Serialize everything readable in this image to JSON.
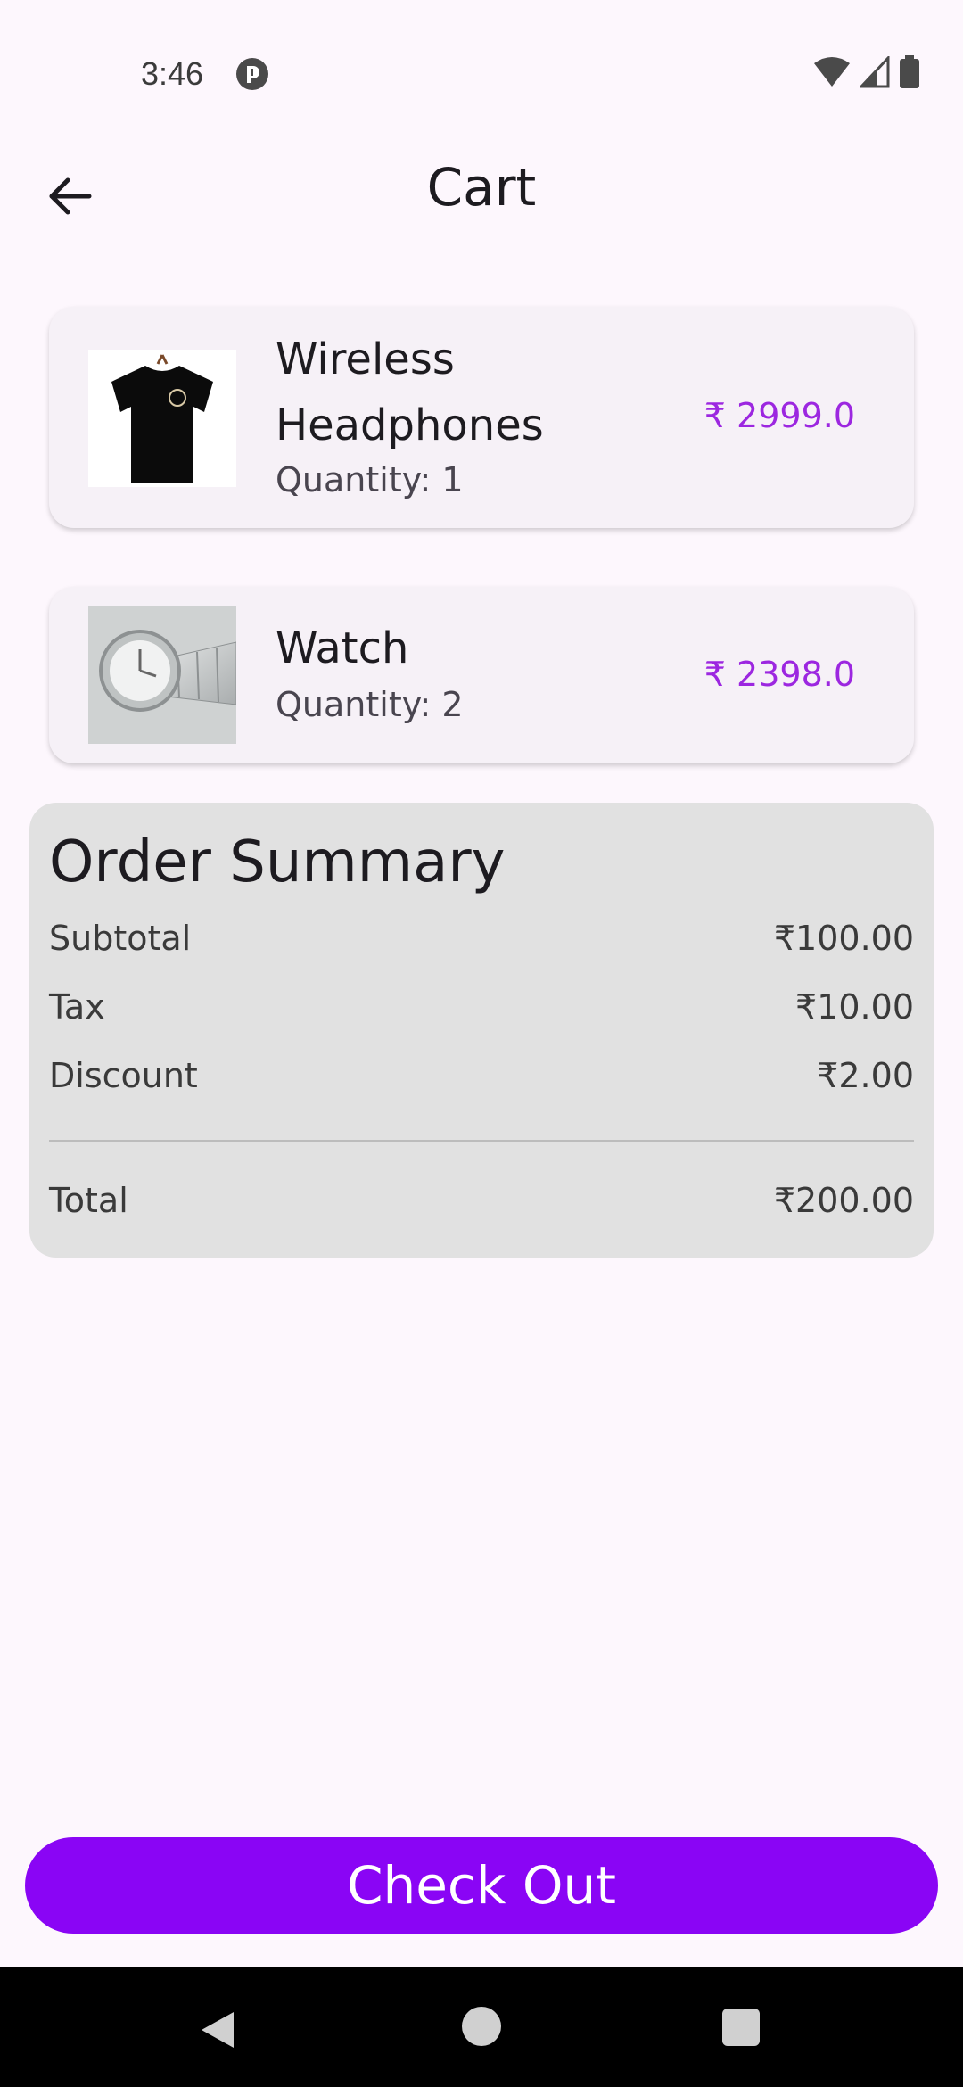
{
  "status_bar": {
    "time": "3:46"
  },
  "app_bar": {
    "title": "Cart"
  },
  "cart": {
    "items": [
      {
        "name": "Wireless Headphones",
        "quantity": "Quantity: 1",
        "price": "₹ 2999.0",
        "image_icon": "black-tshirt-image"
      },
      {
        "name": "Watch",
        "quantity": "Quantity: 2",
        "price": "₹ 2398.0",
        "image_icon": "silver-watch-image"
      }
    ]
  },
  "order_summary": {
    "title": "Order Summary",
    "subtotal_label": "Subtotal",
    "subtotal_value": "₹100.00",
    "tax_label": "Tax",
    "tax_value": "₹10.00",
    "discount_label": "Discount",
    "discount_value": "₹2.00",
    "total_label": "Total",
    "total_value": "₹200.00"
  },
  "checkout": {
    "label": "Check Out"
  },
  "colors": {
    "background": "#FDF7FD",
    "accent": "#8A05F5",
    "price": "#9C27E0",
    "summary_bg": "#E1E1E1"
  }
}
